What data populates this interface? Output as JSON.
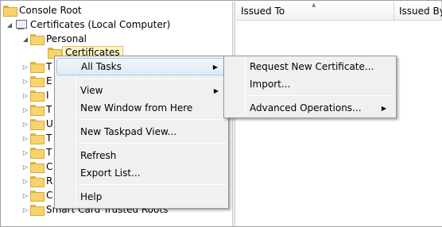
{
  "tree": {
    "root": "Console Root",
    "certificates_local": "Certificates (Local Computer)",
    "personal": "Personal",
    "certificates": "Certificates",
    "partial_items": [
      "T",
      "E",
      "I",
      "T",
      "U",
      "T",
      "T",
      "C",
      "R",
      "C"
    ],
    "smart_card": "Smart Card Trusted Roots"
  },
  "list": {
    "columns": [
      "Issued To",
      "Issued By"
    ]
  },
  "context_menu": {
    "all_tasks": "All Tasks",
    "view": "View",
    "new_window": "New Window from Here",
    "new_taskpad": "New Taskpad View...",
    "refresh": "Refresh",
    "export_list": "Export List...",
    "help": "Help"
  },
  "submenu": {
    "request_new": "Request New Certificate...",
    "import": "Import...",
    "advanced": "Advanced Operations..."
  }
}
